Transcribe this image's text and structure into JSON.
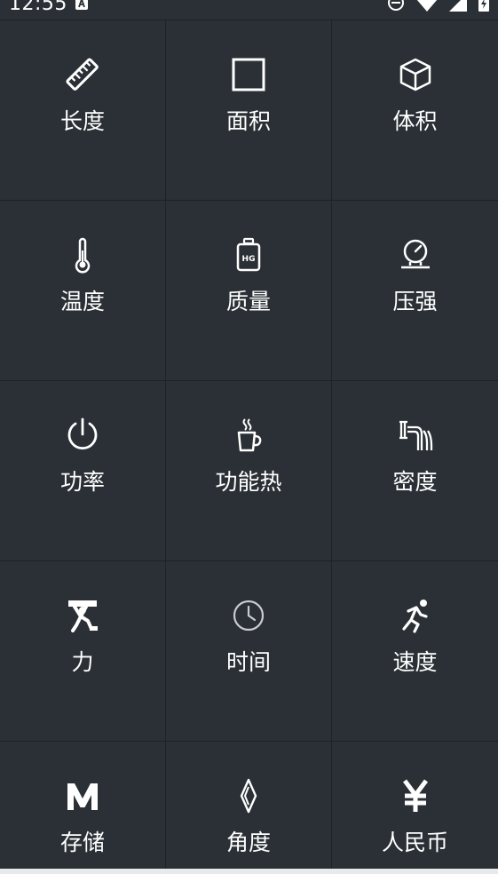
{
  "status_bar": {
    "time": "12:55",
    "icons": [
      "a-notification-icon",
      "do-not-disturb-icon",
      "wifi-icon",
      "signal-icon",
      "battery-charging-icon"
    ]
  },
  "categories": [
    {
      "label": "长度",
      "icon": "ruler-icon"
    },
    {
      "label": "面积",
      "icon": "square-icon"
    },
    {
      "label": "体积",
      "icon": "cube-icon"
    },
    {
      "label": "温度",
      "icon": "thermometer-icon"
    },
    {
      "label": "质量",
      "icon": "weight-icon"
    },
    {
      "label": "压强",
      "icon": "gauge-icon"
    },
    {
      "label": "功率",
      "icon": "power-icon"
    },
    {
      "label": "功能热",
      "icon": "coffee-cup-icon"
    },
    {
      "label": "密度",
      "icon": "density-icon"
    },
    {
      "label": "力",
      "icon": "force-icon"
    },
    {
      "label": "时间",
      "icon": "clock-icon"
    },
    {
      "label": "速度",
      "icon": "running-icon"
    },
    {
      "label": "存储",
      "icon": "storage-m-icon"
    },
    {
      "label": "角度",
      "icon": "angle-icon"
    },
    {
      "label": "人民币",
      "icon": "yuan-icon"
    }
  ],
  "colors": {
    "background": "#2a3035",
    "divider": "#1d2226",
    "text": "#ffffff"
  }
}
